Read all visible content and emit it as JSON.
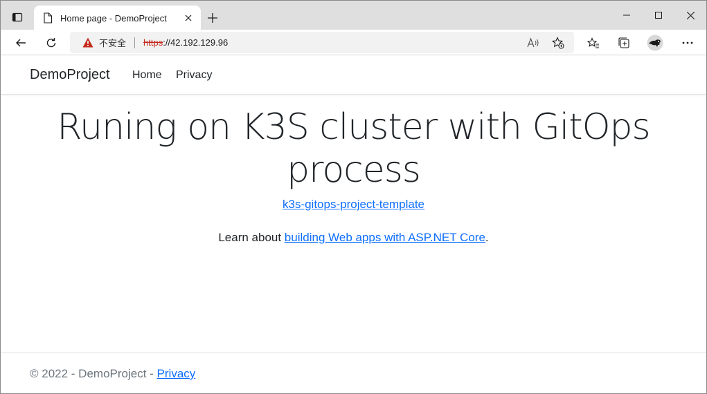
{
  "browser": {
    "tab": {
      "title": "Home page - DemoProject"
    },
    "address": {
      "insecure_label": "不安全",
      "url_scheme": "https",
      "url_rest": "://42.192.129.96"
    },
    "colors": {
      "tabstrip": "#dfdfdf",
      "warning": "#c42b1c",
      "link": "#0d6efd"
    }
  },
  "site": {
    "brand": "DemoProject",
    "nav": {
      "home": "Home",
      "privacy": "Privacy"
    },
    "hero": {
      "line1": "Runing on K3S cluster with GitOps",
      "line2": "process"
    },
    "repo_link": "k3s-gitops-project-template",
    "learn": {
      "prefix": "Learn about ",
      "link": "building Web apps with ASP.NET Core",
      "suffix": "."
    },
    "footer": {
      "copyright": "© 2022 - DemoProject - ",
      "privacy": "Privacy"
    }
  }
}
